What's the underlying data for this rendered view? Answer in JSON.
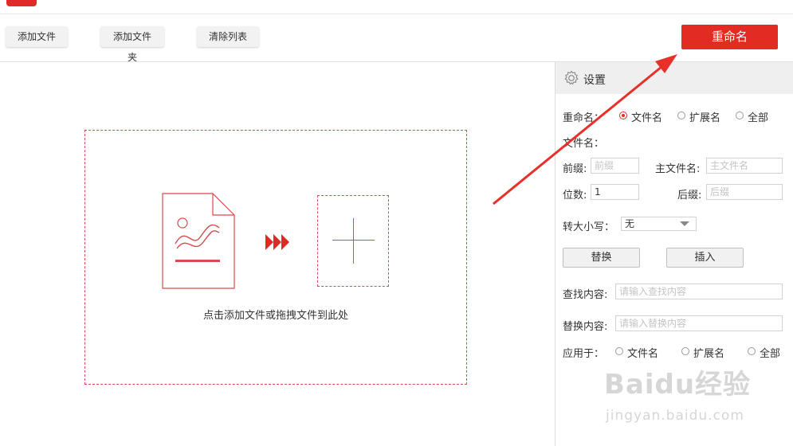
{
  "toolbar": {
    "add_file": "添加文件",
    "add_folder": "添加文件夹",
    "clear_list": "清除列表",
    "rename": "重命名"
  },
  "drop_zone": {
    "hint": "点击添加文件或拖拽文件到此处"
  },
  "settings": {
    "title": "设置",
    "rename_label": "重命名：",
    "rename_options": [
      "文件名",
      "扩展名",
      "全部"
    ],
    "rename_selected": "文件名",
    "filename_label": "文件名：",
    "prefix_label": "前缀:",
    "prefix_placeholder": "前缀",
    "main_name_label": "主文件名:",
    "main_name_placeholder": "主文件名",
    "digits_label": "位数:",
    "digits_value": "1",
    "suffix_label": "后缀:",
    "suffix_placeholder": "后缀",
    "case_label": "转大小写：",
    "case_value": "无",
    "replace_button": "替换",
    "insert_button": "插入",
    "find_label": "查找内容:",
    "find_placeholder": "请输入查找内容",
    "replace_label": "替换内容:",
    "replace_placeholder": "请输入替换内容",
    "apply_label": "应用于：",
    "apply_options": [
      "文件名",
      "扩展名",
      "全部"
    ]
  },
  "watermark": {
    "brand": "Baidu经验",
    "url": "jingyan.baidu.com"
  },
  "colors": {
    "accent": "#e12b23",
    "arrow": "#e8302a"
  }
}
